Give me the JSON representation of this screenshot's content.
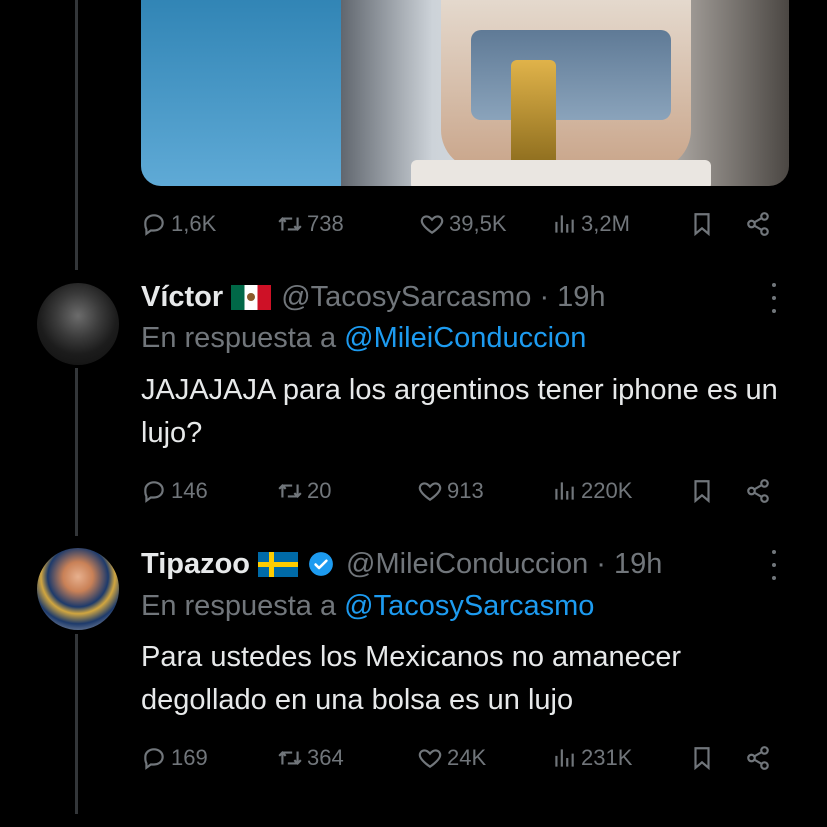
{
  "top_tweet": {
    "stats": {
      "replies": "1,6K",
      "retweets": "738",
      "likes": "39,5K",
      "views": "3,2M"
    }
  },
  "replies": [
    {
      "name": "Víctor",
      "flag": "mexico-flag",
      "handle": "@TacosySarcasmo",
      "time": "· 19h",
      "reply_prefix": "En respuesta a",
      "reply_to": "@MileiConduccion",
      "text": "JAJAJAJA para los argentinos tener iphone es un lujo?",
      "stats": {
        "replies": "146",
        "retweets": "20",
        "likes": "913",
        "views": "220K"
      }
    },
    {
      "name": "Tipazoo",
      "flag": "sweden-flag",
      "verified": true,
      "handle": "@MileiConduccion",
      "time": "· 19h",
      "reply_prefix": "En respuesta a",
      "reply_to": "@TacosySarcasmo",
      "text": "Para ustedes los Mexicanos no amanecer degollado en una bolsa es un lujo",
      "stats": {
        "replies": "169",
        "retweets": "364",
        "likes": "24K",
        "views": "231K"
      }
    }
  ],
  "colors": {
    "background": "#000000",
    "text": "#e7e9ea",
    "muted": "#71767b",
    "link": "#1d9bf0",
    "verified": "#1d9bf0"
  }
}
